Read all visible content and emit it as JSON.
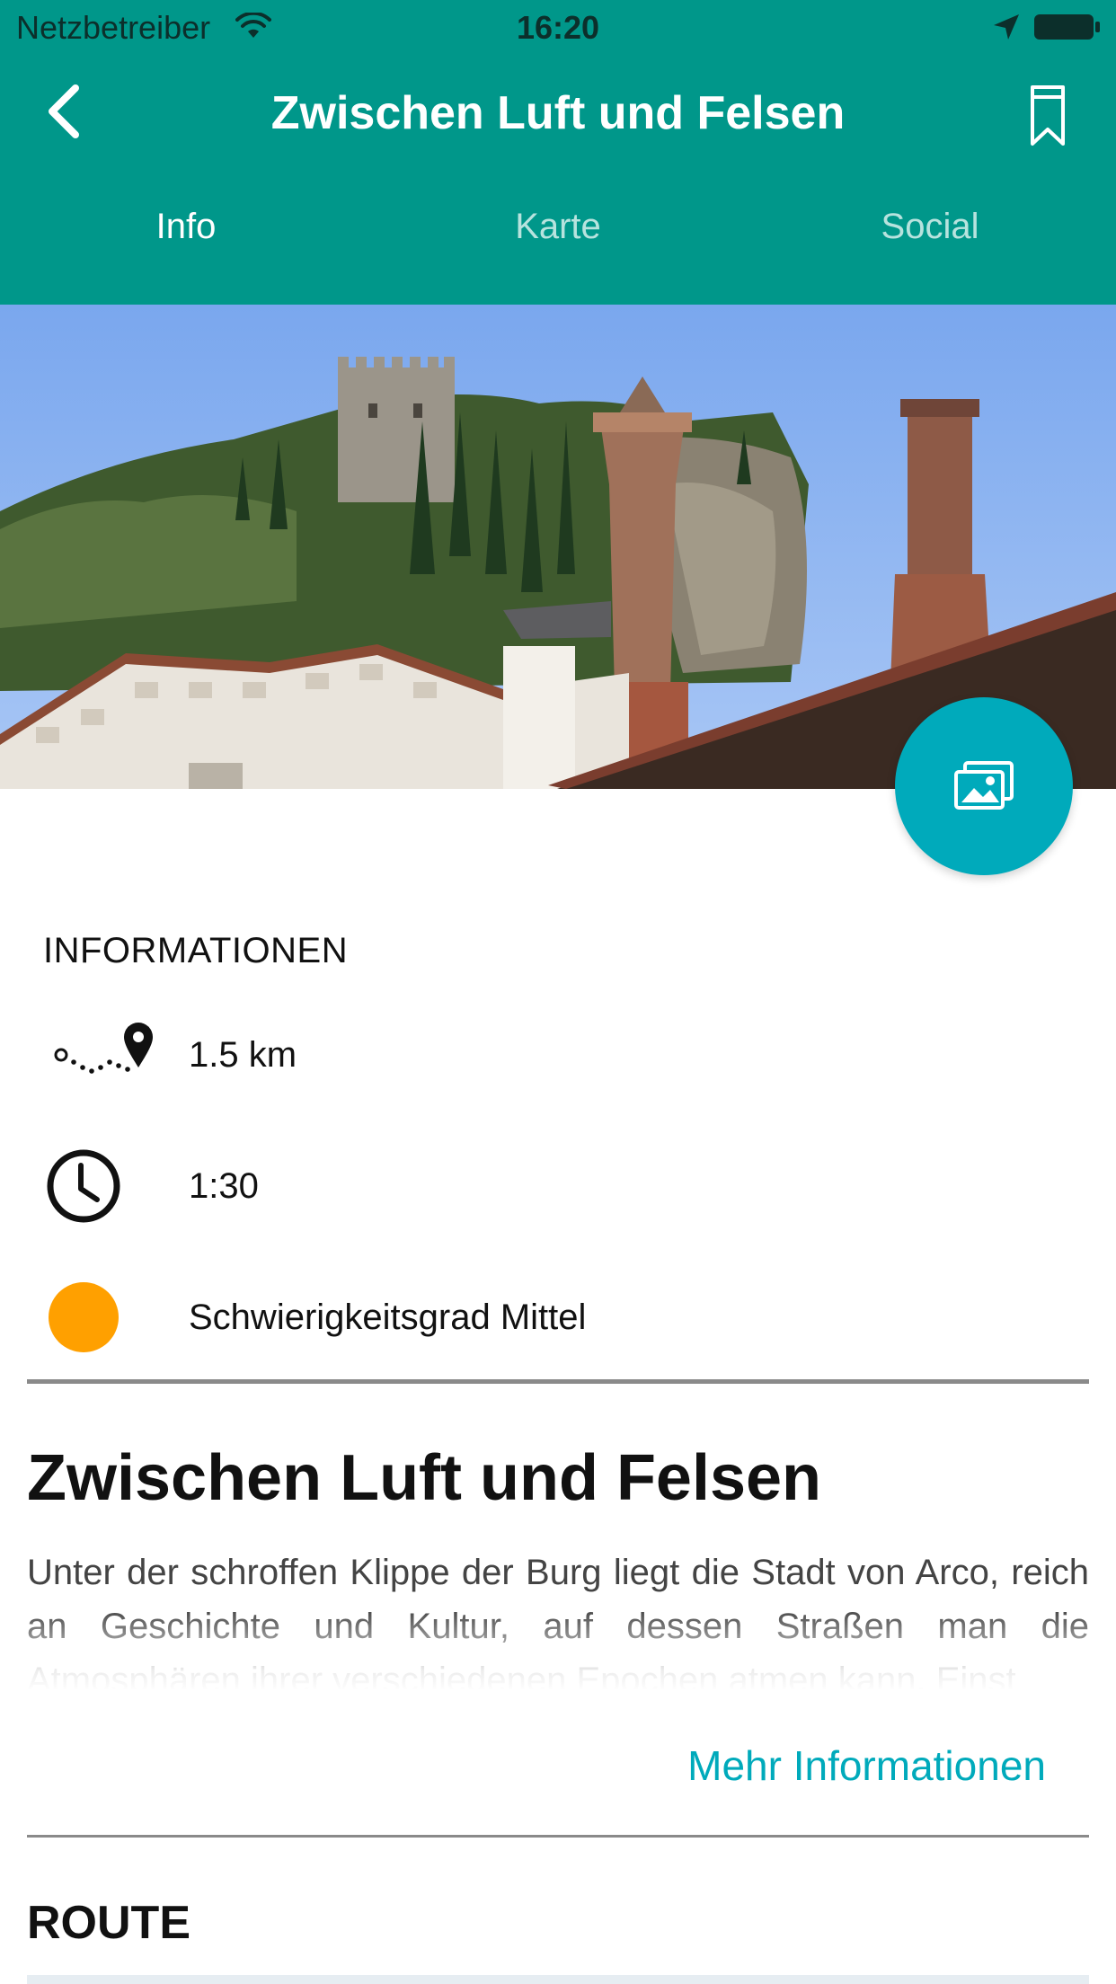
{
  "status_bar": {
    "carrier": "Netzbetreiber",
    "time": "16:20",
    "icons": [
      "wifi-icon",
      "location-arrow-icon",
      "battery-icon"
    ]
  },
  "nav": {
    "title": "Zwischen Luft und Felsen",
    "back_icon": "chevron-left-icon",
    "bookmark_icon": "bookmark-icon"
  },
  "tabs": [
    {
      "label": "Info",
      "active": true
    },
    {
      "label": "Karte",
      "active": false
    },
    {
      "label": "Social",
      "active": false
    }
  ],
  "hero": {
    "fab_icon": "image-gallery-icon"
  },
  "info": {
    "heading": "INFORMATIONEN",
    "rows": [
      {
        "icon": "route-distance-icon",
        "value": "1.5 km"
      },
      {
        "icon": "clock-icon",
        "value": "1:30"
      },
      {
        "icon": "difficulty-dot-icon",
        "value": "Schwierigkeitsgrad Mittel"
      }
    ]
  },
  "detail": {
    "title": "Zwischen Luft und Felsen",
    "text": "Unter der schroffen Klippe der Burg liegt die Stadt von Arco, reich an Geschichte und Kultur, auf dessen Straßen man die Atmosphären ihrer verschiedenen Epochen atmen kann. Einst",
    "more_link": "Mehr Informationen"
  },
  "route": {
    "heading": "ROUTE"
  },
  "colors": {
    "header_bg": "#00978a",
    "accent": "#00aabb",
    "difficulty_medium": "#ffa000",
    "tab_inactive": "#b7e3de"
  }
}
